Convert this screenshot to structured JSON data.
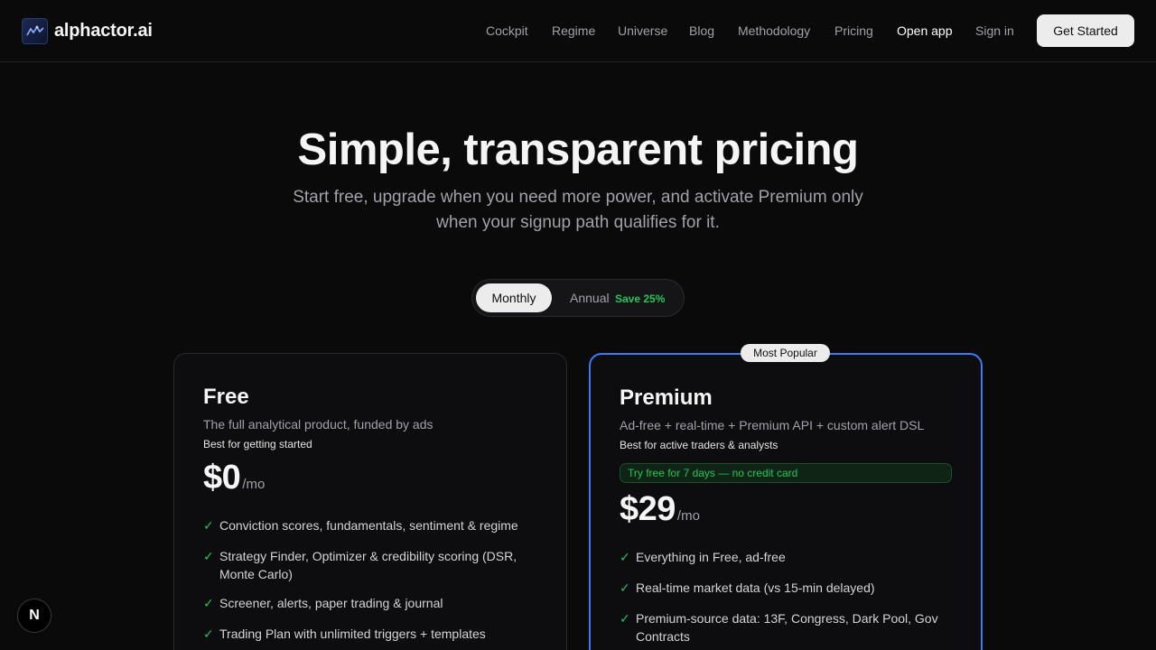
{
  "brand": {
    "name": "alphactor.ai"
  },
  "nav": {
    "items": [
      "Cockpit",
      "Regime",
      "Universe",
      "Blog",
      "Methodology",
      "Pricing"
    ],
    "open_app": "Open app",
    "sign_in": "Sign in",
    "get_started": "Get Started"
  },
  "hero": {
    "title": "Simple, transparent pricing",
    "subtitle": "Start free, upgrade when you need more power, and activate Premium only when your signup path qualifies for it."
  },
  "billing_toggle": {
    "monthly": "Monthly",
    "annual": "Annual",
    "save": "Save 25%",
    "selected": "Monthly"
  },
  "plans": [
    {
      "name": "Free",
      "description": "The full analytical product, funded by ads",
      "best_for": "Best for getting started",
      "price": "$0",
      "unit": "/mo",
      "features": [
        "Conviction scores, fundamentals, sentiment & regime",
        "Strategy Finder, Optimizer & credibility scoring (DSR, Monte Carlo)",
        "Screener, alerts, paper trading & journal",
        "Trading Plan with unlimited triggers + templates"
      ]
    },
    {
      "name": "Premium",
      "badge": "Most Popular",
      "description": "Ad-free + real-time + Premium API + custom alert DSL",
      "best_for": "Best for active traders & analysts",
      "trial": "Try free for 7 days — no credit card",
      "price": "$29",
      "unit": "/mo",
      "features": [
        "Everything in Free, ad-free",
        "Real-time market data (vs 15-min delayed)",
        "Premium-source data: 13F, Congress, Dark Pool, Gov Contracts"
      ]
    }
  ],
  "floating": {
    "label": "N"
  },
  "colors": {
    "background": "#0a0a0b",
    "accent": "#3b7cf5",
    "success": "#22c55e"
  },
  "icons": {
    "logo": "logo-icon",
    "check": "check-icon"
  }
}
